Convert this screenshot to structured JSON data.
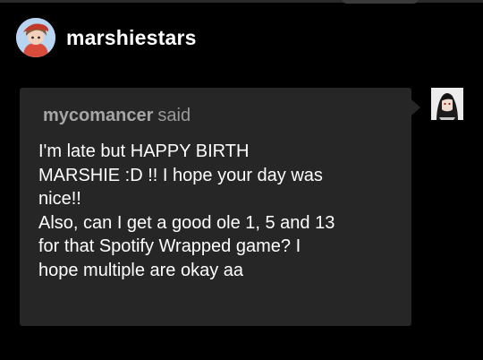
{
  "post": {
    "author": "marshiestars"
  },
  "ask": {
    "asker": "mycomancer",
    "said_label": "said",
    "message_lines": [
      "I'm late but HAPPY BIRTH",
      "MARSHIE :D !! I hope your day was",
      "nice!!",
      "Also, can I get a good ole 1, 5 and 13",
      "for that Spotify Wrapped game? I",
      "hope multiple are okay aa"
    ]
  },
  "colors": {
    "background": "#000000",
    "bubble": "#262626",
    "asker_text": "#9a9a9a",
    "text": "#ffffff"
  }
}
